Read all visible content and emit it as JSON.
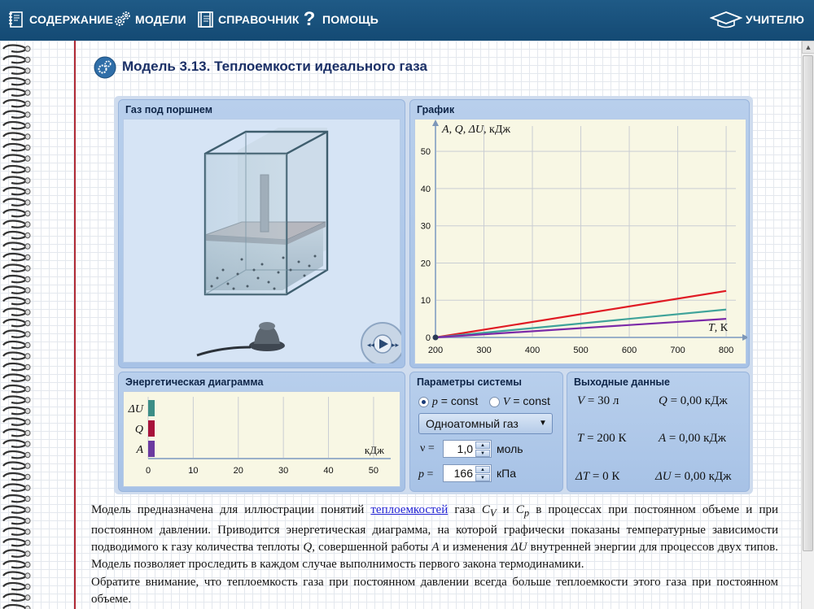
{
  "nav": {
    "contents": "СОДЕРЖАНИЕ",
    "models": "МОДЕЛИ",
    "reference": "СПРАВОЧНИК",
    "help": "ПОМОЩЬ",
    "teacher": "УЧИТЕЛЮ"
  },
  "title": "Модель 3.13.  Теплоемкости идеального газа",
  "panels": {
    "gas": "Газ под поршнем",
    "graph": "График",
    "energy": "Энергетическая диаграмма",
    "params": "Параметры системы",
    "output": "Выходные данные"
  },
  "graph": {
    "ylabel_parts": {
      "y_a": "A",
      "y_sep1": ", ",
      "y_q": "Q",
      "y_sep2": ", ",
      "y_du": "ΔU",
      "y_unit": ", кДж"
    },
    "xlabel_parts": {
      "x_t": "T",
      "x_unit": ", К"
    }
  },
  "chart_data": {
    "type": "line",
    "x": [
      200,
      800
    ],
    "xlim": [
      200,
      820
    ],
    "ylim": [
      0,
      52
    ],
    "xticks": [
      "200",
      "300",
      "400",
      "500",
      "600",
      "700",
      "800"
    ],
    "yticks": [
      "0",
      "10",
      "20",
      "30",
      "40",
      "50"
    ],
    "grid": true,
    "series": [
      {
        "color": "#e01b24",
        "values": [
          0,
          12.5
        ]
      },
      {
        "color": "#3fa39a",
        "values": [
          0,
          7.5
        ]
      },
      {
        "color": "#7b2aa8",
        "values": [
          0,
          5.0
        ]
      }
    ]
  },
  "energy": {
    "labels": [
      "ΔU",
      "Q",
      "A"
    ],
    "xticks": [
      "0",
      "10",
      "20",
      "30",
      "40",
      "50"
    ],
    "unit": "кДж",
    "bar_colors": [
      "#3c8e86",
      "#a8123a",
      "#6b3aa0"
    ]
  },
  "params": {
    "p_const_sym": "p",
    "p_const_txt": " = const",
    "v_const_sym": "V",
    "v_const_txt": " = const",
    "gas_type": "Одноатомный газ",
    "nu_label": "ν =",
    "nu_value": "1,0",
    "nu_unit": "моль",
    "p_label_sym": "p",
    "p_label_txt": " =",
    "p_value": "166",
    "p_unit": "кПа"
  },
  "output": {
    "v_sym": "V",
    "v_val": " = 30 л",
    "q_sym": "Q",
    "q_val": " = 0,00 кДж",
    "t_sym": "T",
    "t_val": " = 200 К",
    "a_sym": "A",
    "a_val": " = 0,00 кДж",
    "dt_sym": "ΔT",
    "dt_val": " = 0 К",
    "du_sym": "ΔU",
    "du_val": " = 0,00 кДж"
  },
  "text": {
    "p1_a": "Модель предназначена для иллюстрации понятий ",
    "p1_link": "теплоемкостей",
    "p1_b": " газа ",
    "cv_c": "C",
    "cv_sub": "V",
    "p1_and": " и ",
    "cp_c": "C",
    "cp_sub": "p",
    "p1_c": " в процессах при постоянном объеме и при постоянном давлении. Приводится энергетическая диаграмма, на которой графически показаны температурные зависимости подводимого к газу количества теплоты ",
    "q_sym": "Q",
    "p1_d": ", совершенной работы ",
    "a_sym": "A",
    "p1_e": " и изменения ",
    "du_sym": "ΔU",
    "p1_f": " внутренней энергии для процессов двух типов. Модель позволяет проследить в каждом случае выполнимость первого закона термодинамики.",
    "p2": "Обратите внимание, что теплоемкость газа при постоянном давлении всегда больше теплоемкости этого газа при постоянном объеме."
  }
}
